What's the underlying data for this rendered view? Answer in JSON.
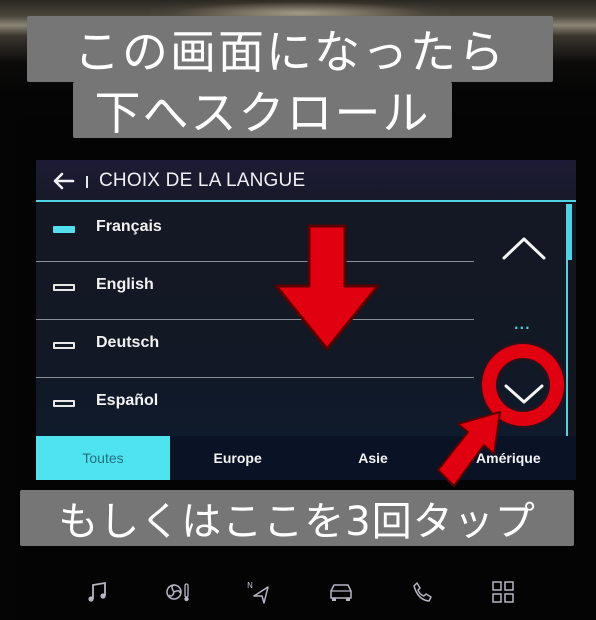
{
  "captions": {
    "line1": "この画面になったら",
    "line2": "下へスクロール",
    "line3": "もしくはここを3回タップ"
  },
  "screen": {
    "title": "CHOIX DE LA LANGUE",
    "back_icon": "arrow-left-icon",
    "languages": [
      {
        "label": "Français",
        "selected": true
      },
      {
        "label": "English",
        "selected": false
      },
      {
        "label": "Deutsch",
        "selected": false
      },
      {
        "label": "Español",
        "selected": false
      }
    ],
    "scroll_up_icon": "chevron-up-icon",
    "scroll_down_icon": "chevron-down-icon",
    "more_indicator": "...",
    "tabs": [
      {
        "label": "Toutes",
        "active": true
      },
      {
        "label": "Europe",
        "active": false
      },
      {
        "label": "Asie",
        "active": false
      },
      {
        "label": "Amérique",
        "active": false
      }
    ]
  },
  "bottom_bar": {
    "icons": [
      "music-icon",
      "climate-icon",
      "navigation-icon",
      "car-icon",
      "phone-icon",
      "apps-grid-icon"
    ]
  },
  "colors": {
    "accent": "#4fd3e3",
    "annotation_red": "#e00010",
    "caption_bg": "#767676"
  }
}
